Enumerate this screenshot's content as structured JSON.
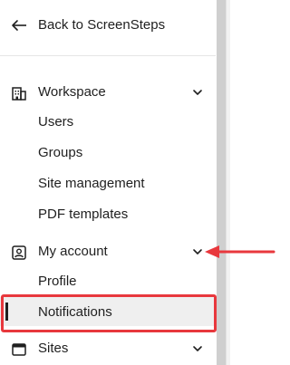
{
  "nav": {
    "back_label": "Back to ScreenSteps"
  },
  "sections": {
    "workspace": {
      "label": "Workspace",
      "icon": "building-icon",
      "items": [
        "Users",
        "Groups",
        "Site management",
        "PDF templates"
      ]
    },
    "account": {
      "label": "My account",
      "icon": "user-badge-icon",
      "items": [
        "Profile",
        "Notifications"
      ]
    },
    "sites": {
      "label": "Sites",
      "icon": "browser-window-icon"
    }
  },
  "active_item": "Notifications",
  "colors": {
    "annotation_red": "#e8383d",
    "active_bg": "#efefef",
    "scrollbar": "#cfcfcf"
  }
}
